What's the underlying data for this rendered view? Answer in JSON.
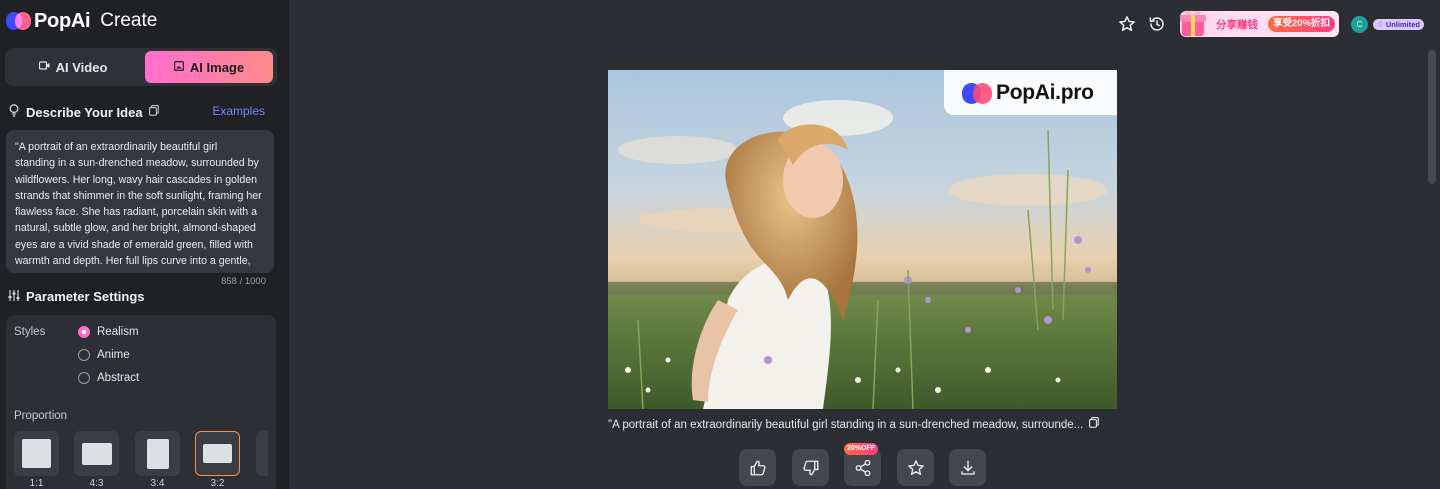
{
  "brand": {
    "name": "PopAi",
    "section": "Create"
  },
  "mode_tabs": [
    {
      "label": "AI Video",
      "active": false
    },
    {
      "label": "AI Image",
      "active": true
    }
  ],
  "describe": {
    "title": "Describe Your Idea",
    "examples_label": "Examples",
    "prompt_lines": [
      "\"A portrait of an extraordinarily beautiful girl",
      "standing in a sun-drenched meadow, surrounded by",
      "wildflowers. Her long, wavy hair cascades in golden",
      "strands that shimmer in the soft sunlight, framing her",
      "flawless face. She has radiant, porcelain skin with a",
      "natural, subtle glow, and her bright, almond-shaped",
      "eyes are a vivid shade of emerald green, filled with",
      "warmth and depth. Her full lips curve into a gentle,"
    ],
    "char_count": "858 / 1000"
  },
  "parameters": {
    "title": "Parameter Settings",
    "styles_label": "Styles",
    "styles": [
      {
        "label": "Realism",
        "selected": true
      },
      {
        "label": "Anime",
        "selected": false
      },
      {
        "label": "Abstract",
        "selected": false
      }
    ],
    "proportion_label": "Proportion",
    "proportions": [
      {
        "label": "1:1",
        "selected": false
      },
      {
        "label": "4:3",
        "selected": false
      },
      {
        "label": "3:4",
        "selected": false
      },
      {
        "label": "3:2",
        "selected": true
      }
    ]
  },
  "topbar": {
    "icons": [
      "star-icon",
      "history-icon"
    ],
    "promo_text": "分享赚钱",
    "promo_badge": "享受20%折扣",
    "avatar_initial": "C",
    "plan_badge": "Unlimited"
  },
  "result": {
    "watermark": "PopAi.pro",
    "caption": "\"A portrait of an extraordinarily beautiful girl standing in a sun-drenched meadow, surrounde...",
    "share_badge": "20%OFF"
  },
  "colors": {
    "accent_gradient_start": "#ff6fd0",
    "accent_gradient_end": "#ff8a8a",
    "link": "#6f8bff",
    "sidebar_bg": "#1f2125",
    "main_bg": "#2b2e33"
  }
}
